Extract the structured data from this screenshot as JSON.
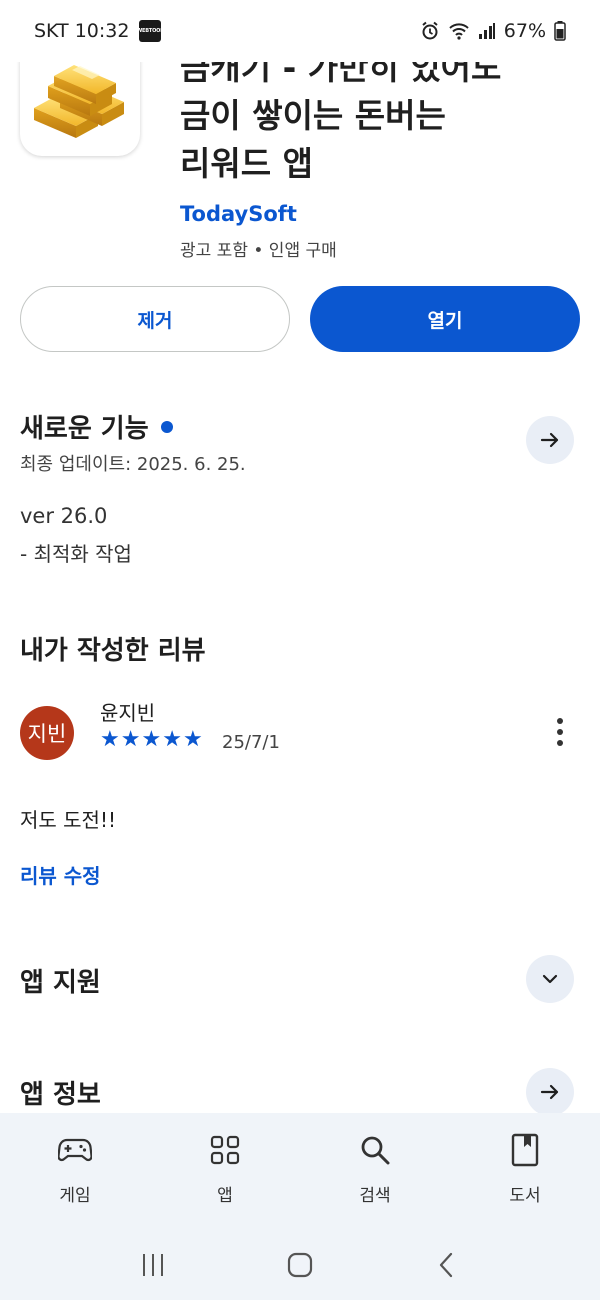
{
  "status_bar": {
    "carrier_time": "SKT 10:32",
    "badge_line1": "WEB",
    "badge_line2": "TOON",
    "battery": "67%"
  },
  "app": {
    "title_line1": "금캐기 - 가만히 있어도",
    "title_line2": "금이 쌓이는 돈버는",
    "title_line3": "리워드 앱",
    "developer": "TodaySoft",
    "meta": "광고 포함 • 인앱 구매"
  },
  "actions": {
    "uninstall_label": "제거",
    "open_label": "열기"
  },
  "whats_new": {
    "title": "새로운 기능",
    "last_updated": "최종 업데이트: 2025. 6. 25.",
    "version": "ver 26.0",
    "note": "- 최적화 작업"
  },
  "my_review": {
    "section_title": "내가 작성한 리뷰",
    "avatar_text": "지빈",
    "reviewer": "윤지빈",
    "rating": 5,
    "date": "25/7/1",
    "text": "저도 도전!!",
    "edit_label": "리뷰 수정"
  },
  "sections": {
    "app_support": "앱 지원",
    "app_info": "앱 정보"
  },
  "bottom_nav": {
    "items": [
      {
        "label": "게임",
        "icon": "gamepad-icon"
      },
      {
        "label": "앱",
        "icon": "apps-grid-icon"
      },
      {
        "label": "검색",
        "icon": "search-icon"
      },
      {
        "label": "도서",
        "icon": "book-icon"
      }
    ]
  },
  "colors": {
    "accent": "#0b57d0",
    "avatar_bg": "#b5371a",
    "round_button_bg": "#e9eef6",
    "nav_bg": "#f0f4f9"
  }
}
